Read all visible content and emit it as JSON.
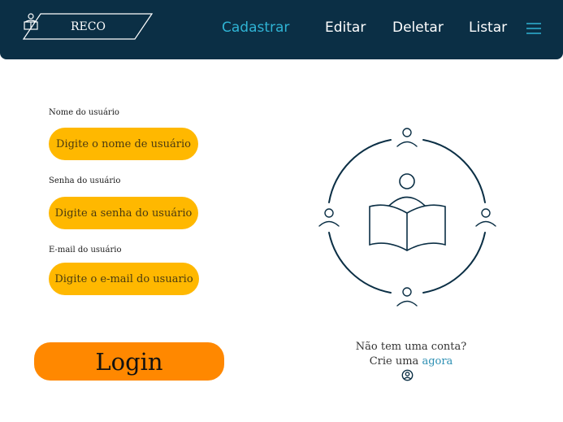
{
  "app": {
    "logo_text": "RECO",
    "logo_icon": "book-reader-icon"
  },
  "nav": {
    "items": [
      {
        "label": "Cadastrar",
        "active": true
      },
      {
        "label": "Editar",
        "active": false
      },
      {
        "label": "Deletar",
        "active": false
      },
      {
        "label": "Listar",
        "active": false
      }
    ],
    "menu_icon": "hamburger-menu-icon"
  },
  "form": {
    "username": {
      "label": "Nome do usuário",
      "placeholder": "Digite o nome de usuário",
      "value": ""
    },
    "password": {
      "label": "Senha do usuário",
      "placeholder": "Digite a senha do usuário",
      "value": ""
    },
    "email": {
      "label": "E-mail do usuário",
      "placeholder": "Digite o e-mail do usuario",
      "value": ""
    },
    "login_label": "Login"
  },
  "signup": {
    "question": "Não tem uma conta?",
    "prompt": "Crie uma",
    "link_label": "agora",
    "icon": "user-circle-icon"
  },
  "illustration": {
    "icon": "community-reading-icon"
  },
  "colors": {
    "navbar": "#0b2f45",
    "nav_active": "#2fb3d4",
    "field_bg": "#ffb800",
    "login_bg": "#ff8800",
    "link": "#2c8fb3"
  }
}
